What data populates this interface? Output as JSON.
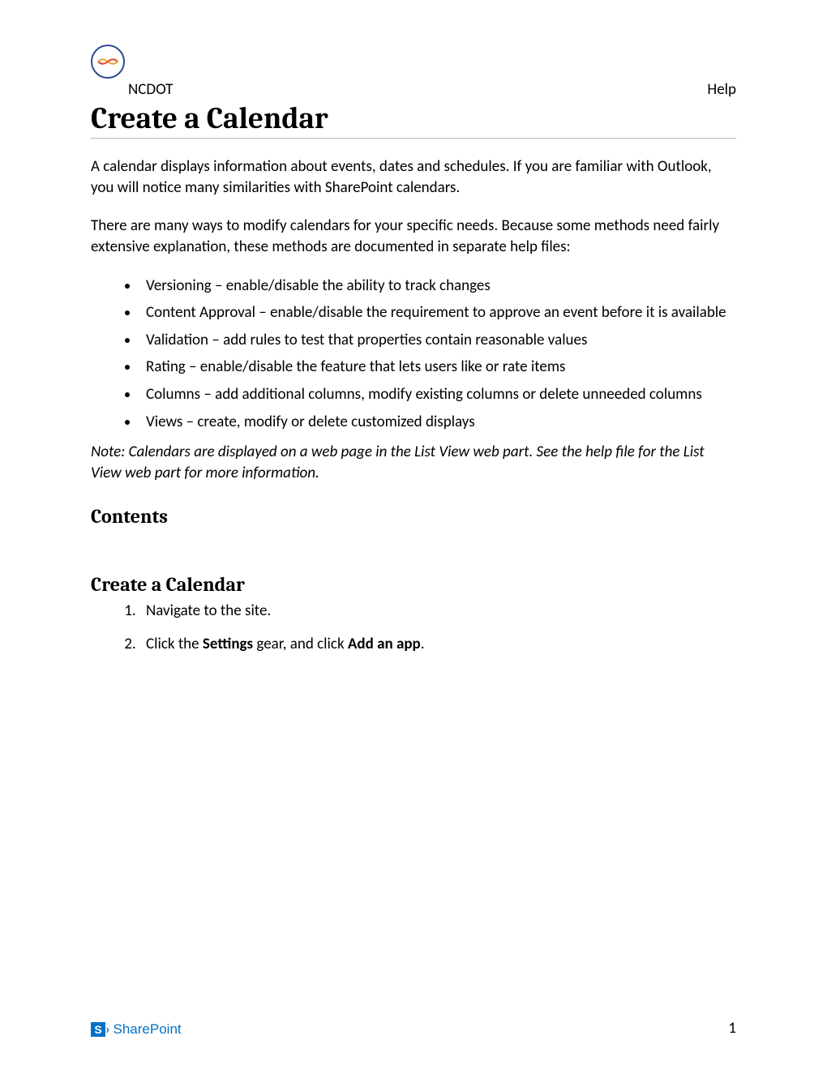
{
  "header": {
    "org": "NCDOT",
    "help": "Help"
  },
  "title": "Create a Calendar",
  "intro_para1": "A calendar displays information about events, dates and schedules. If you are familiar with Outlook, you will notice many similarities with SharePoint calendars.",
  "intro_para2": "There are many ways to modify calendars for your specific needs. Because some methods need fairly extensive explanation, these methods are documented in separate help files:",
  "bullets": [
    "Versioning – enable/disable the ability to track changes",
    "Content Approval – enable/disable the requirement to approve an event before it is available",
    "Validation – add rules to test that properties contain reasonable values",
    "Rating – enable/disable the feature that lets users like or rate items",
    "Columns – add additional columns, modify existing columns or delete unneeded columns",
    "Views – create, modify or delete customized displays"
  ],
  "note": "Note: Calendars are displayed on a web page in the List View web part. See the help file for the List View web part for more information.",
  "contents_heading": "Contents",
  "section_heading": "Create a Calendar",
  "steps": {
    "step1": "Navigate to the site.",
    "step2_a": "Click the ",
    "step2_b": "Settings",
    "step2_c": " gear, and click ",
    "step2_d": "Add an app",
    "step2_e": "."
  },
  "footer": {
    "sp_letter": "S",
    "sp_arrow": "›",
    "sp_text": "SharePoint",
    "page_number": "1"
  }
}
